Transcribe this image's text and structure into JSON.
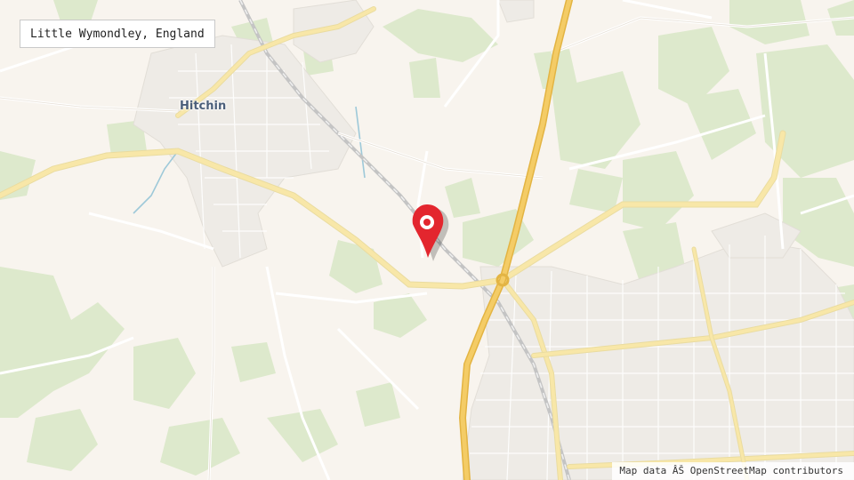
{
  "map": {
    "location_label": "Little Wymondley, England",
    "town_labels": [
      "Hitchin"
    ],
    "attribution": "Map data ÂŠ OpenStreetMap contributors",
    "marker": "map-pin-icon",
    "colors": {
      "land": "#f8f4ee",
      "woodland": "#dde9cc",
      "motorway": "#f4cc66",
      "major_road": "#f8e7a8",
      "minor_road": "#ffffff",
      "urban_block": "#eeebe6",
      "railway": "#c8c8c8",
      "water": "#9ec9d9",
      "marker": "#e3262e",
      "town_label": "#4b5f7a"
    }
  }
}
